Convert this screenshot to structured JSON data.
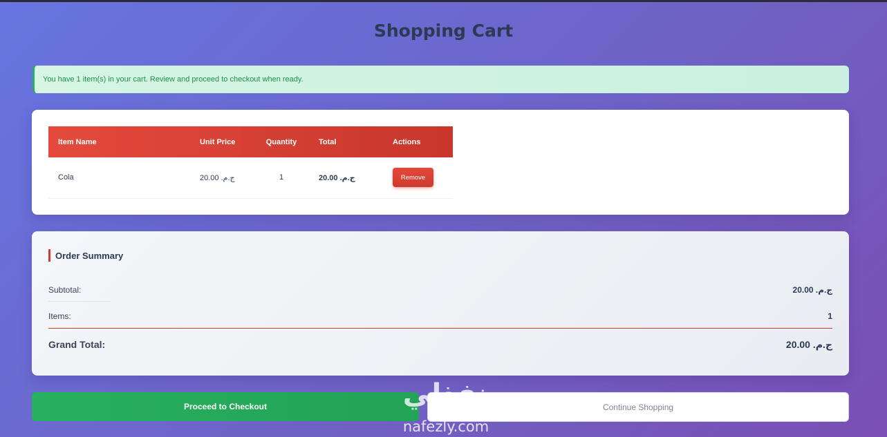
{
  "page": {
    "title": "Shopping Cart"
  },
  "alert": {
    "message": "You have 1 item(s) in your cart. Review and proceed to checkout when ready."
  },
  "cart": {
    "columns": [
      "Item Name",
      "Unit Price",
      "Quantity",
      "Total",
      "Actions"
    ],
    "rows": [
      {
        "name": "Cola",
        "unit_price": "20.00 .ج.م",
        "quantity": "1",
        "total": "20.00 .ج.م",
        "action_label": "Remove"
      }
    ]
  },
  "summary": {
    "title": "Order Summary",
    "subtotal_label": "Subtotal:",
    "subtotal_value": "20.00 .ج.م",
    "items_label": "Items:",
    "items_value": "1",
    "grand_total_label": "Grand Total:",
    "grand_total_value": "20.00 .ج.م"
  },
  "actions": {
    "checkout_label": "Proceed to Checkout",
    "continue_label": "Continue Shopping"
  },
  "watermark": {
    "arabic": "نفذلي",
    "latin": "nafezly.com"
  },
  "colors": {
    "accent_red": "#d33a2e",
    "success_green": "#27ae60",
    "title_navy": "#2c3a55"
  }
}
